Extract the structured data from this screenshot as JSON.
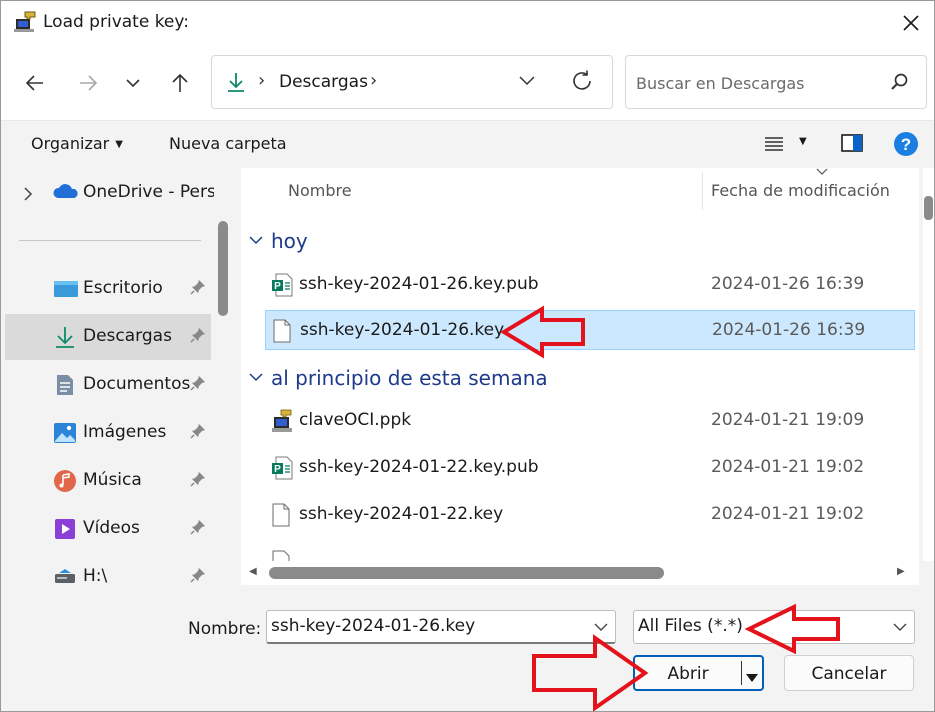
{
  "window": {
    "title": "Load private key:"
  },
  "nav": {
    "back": "back",
    "forward": "forward",
    "recent": "recent-locations",
    "up": "up"
  },
  "address": {
    "crumb": "Descargas",
    "separator": "›"
  },
  "search": {
    "placeholder": "Buscar en Descargas"
  },
  "commands": {
    "organize": "Organizar",
    "new_folder": "Nueva carpeta"
  },
  "sidebar": {
    "items": [
      {
        "label": "OneDrive - Perso",
        "icon": "onedrive-icon"
      },
      {
        "label": "Escritorio",
        "icon": "desktop-folder-icon"
      },
      {
        "label": "Descargas",
        "icon": "downloads-icon"
      },
      {
        "label": "Documentos",
        "icon": "documents-icon"
      },
      {
        "label": "Imágenes",
        "icon": "pictures-icon"
      },
      {
        "label": "Música",
        "icon": "music-icon"
      },
      {
        "label": "Vídeos",
        "icon": "videos-icon"
      },
      {
        "label": "H:\\",
        "icon": "drive-icon"
      }
    ]
  },
  "columns": {
    "name": "Nombre",
    "modified": "Fecha de modificación"
  },
  "groups": [
    {
      "label": "hoy",
      "files": [
        {
          "name": "ssh-key-2024-01-26.key.pub",
          "date": "2024-01-26 16:39",
          "icon": "publisher-file-icon"
        },
        {
          "name": "ssh-key-2024-01-26.key",
          "date": "2024-01-26 16:39",
          "icon": "blank-file-icon",
          "selected": true
        }
      ]
    },
    {
      "label": "al principio de esta semana",
      "files": [
        {
          "name": "claveOCI.ppk",
          "date": "2024-01-21 19:09",
          "icon": "putty-key-icon"
        },
        {
          "name": "ssh-key-2024-01-22.key.pub",
          "date": "2024-01-21 19:02",
          "icon": "publisher-file-icon"
        },
        {
          "name": "ssh-key-2024-01-22.key",
          "date": "2024-01-21 19:02",
          "icon": "blank-file-icon"
        }
      ]
    }
  ],
  "bottom": {
    "filename_label": "Nombre:",
    "filename_value": "ssh-key-2024-01-26.key",
    "filetype_value": "All Files (*.*)",
    "open_label": "Abrir",
    "cancel_label": "Cancelar"
  },
  "colors": {
    "accent": "#005fb8",
    "selection": "#cce8ff",
    "annotation": "#e3121b"
  }
}
